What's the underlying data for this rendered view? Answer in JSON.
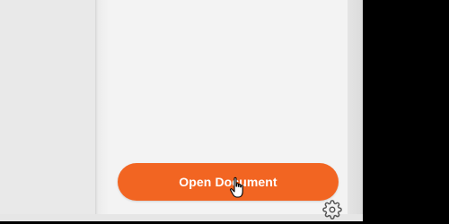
{
  "panel": {
    "open_button_label": "Open Document"
  },
  "icons": {
    "settings": "gear-icon",
    "pointer": "hand-cursor-icon"
  },
  "colors": {
    "accent": "#f26522",
    "panel_background": "#f3f3f3",
    "left_pane": "#e9e9e9",
    "outside": "#000000"
  }
}
